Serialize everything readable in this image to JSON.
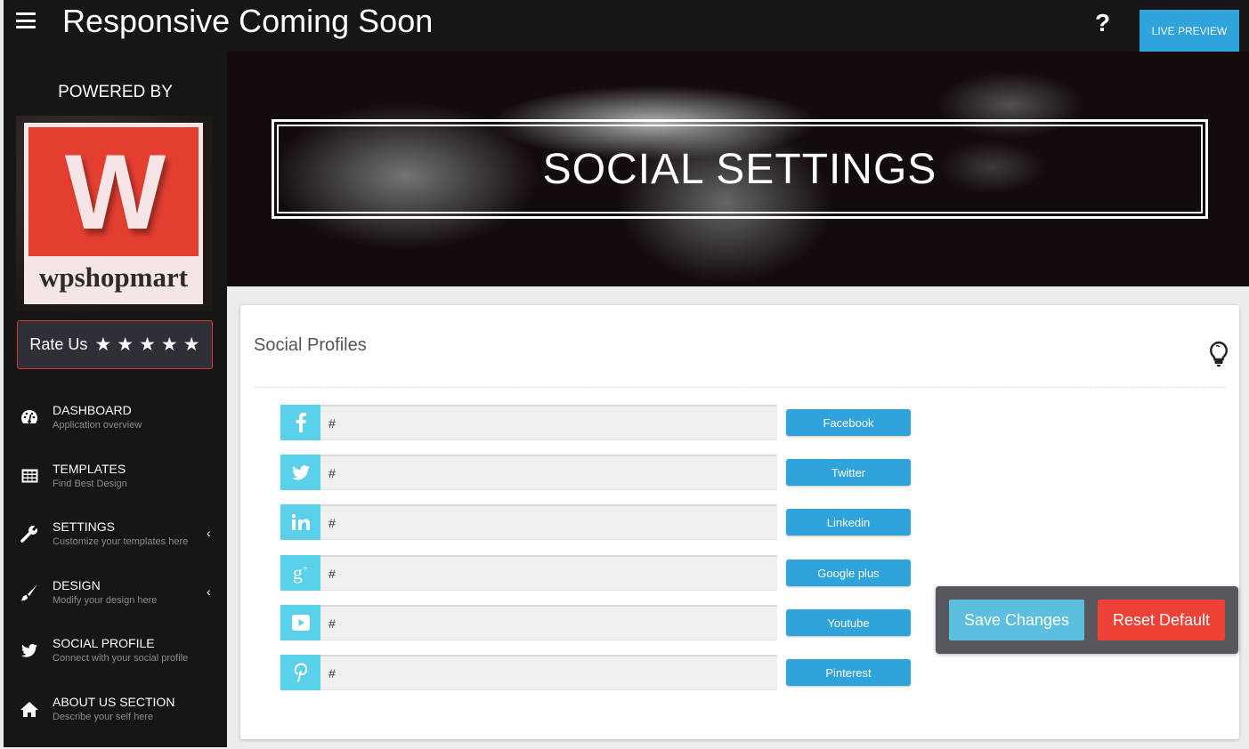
{
  "header": {
    "title": "Responsive Coming Soon",
    "help_label": "?",
    "live_preview_label": "LIVE PREVIEW",
    "menu_icon": "hamburger-icon"
  },
  "sidebar": {
    "powered_by": "POWERED BY",
    "logo_letter": "W",
    "logo_text": "wpshopmart",
    "rate_us": {
      "label": "Rate Us",
      "stars": [
        "★",
        "★",
        "★",
        "★",
        "★"
      ]
    },
    "items": [
      {
        "title": "DASHBOARD",
        "subtitle": "Application overview",
        "icon": "dashboard-icon",
        "has_submenu": false
      },
      {
        "title": "TEMPLATES",
        "subtitle": "Find Best Design",
        "icon": "grid-icon",
        "has_submenu": false
      },
      {
        "title": "SETTINGS",
        "subtitle": "Customize your templates here",
        "icon": "wrench-icon",
        "has_submenu": true
      },
      {
        "title": "DESIGN",
        "subtitle": "Modify your design here",
        "icon": "paintbrush-icon",
        "has_submenu": true
      },
      {
        "title": "SOCIAL PROFILE",
        "subtitle": "Connect with your social profile",
        "icon": "twitter-icon",
        "has_submenu": false
      },
      {
        "title": "ABOUT US SECTION",
        "subtitle": "Describe your self here",
        "icon": "home-icon",
        "has_submenu": false
      }
    ],
    "chevron": "‹"
  },
  "hero": {
    "title": "SOCIAL SETTINGS"
  },
  "card": {
    "title": "Social Profiles",
    "hint_icon": "lightbulb-icon",
    "profiles": [
      {
        "network": "Facebook",
        "icon": "facebook-icon",
        "value": "#",
        "button_label": "Facebook"
      },
      {
        "network": "Twitter",
        "icon": "twitter-icon",
        "value": "#",
        "button_label": "Twitter"
      },
      {
        "network": "Linkedin",
        "icon": "linkedin-icon",
        "value": "#",
        "button_label": "Linkedin"
      },
      {
        "network": "Google plus",
        "icon": "google-plus-icon",
        "value": "#",
        "button_label": "Google plus"
      },
      {
        "network": "Youtube",
        "icon": "youtube-icon",
        "value": "#",
        "button_label": "Youtube"
      },
      {
        "network": "Pinterest",
        "icon": "pinterest-icon",
        "value": "#",
        "button_label": "Pinterest"
      }
    ]
  },
  "actions": {
    "save_label": "Save Changes",
    "reset_label": "Reset Default"
  },
  "colors": {
    "accent_blue": "#2fa3dc",
    "icon_cyan": "#5bd0ea",
    "save_blue": "#5bc0de",
    "reset_red": "#f04137",
    "sidebar_bg": "#171516",
    "logo_red": "#e43e31"
  }
}
